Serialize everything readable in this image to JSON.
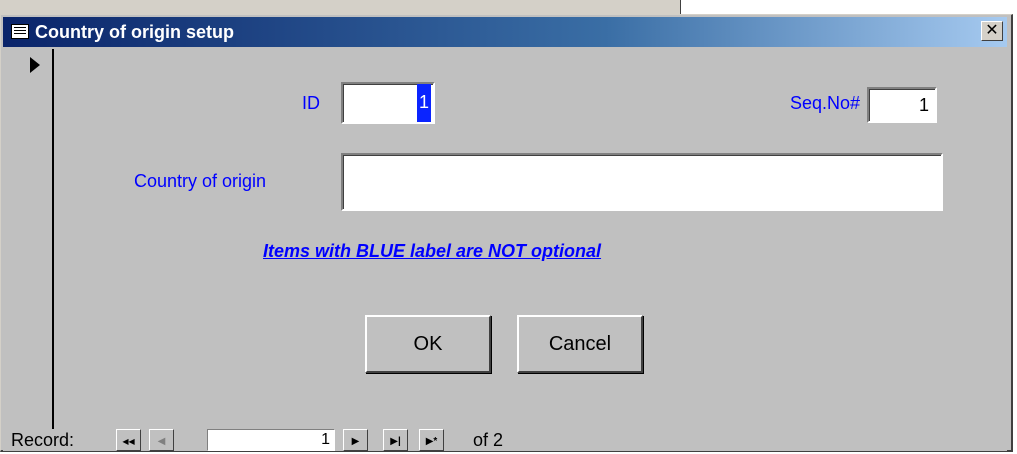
{
  "window": {
    "title": "Country of origin setup",
    "close_glyph": "✕"
  },
  "form": {
    "id_label": "ID",
    "id_value": "1",
    "seq_label": "Seq.No#",
    "seq_value": "1",
    "country_label": "Country of origin",
    "country_value": "",
    "notice": "Items with BLUE label are NOT optional"
  },
  "buttons": {
    "ok": "OK",
    "cancel": "Cancel"
  },
  "navigation": {
    "record_label": "Record:",
    "current": "1",
    "of_text": "of",
    "total": "2",
    "first_glyph": "◀◀",
    "prev_glyph": "◀",
    "next_glyph": "▶",
    "last_glyph": "▶|",
    "new_glyph": "▶*"
  },
  "colors": {
    "label_blue": "#0000ff",
    "title_blue": "#0a246a",
    "face": "#c0c0c0"
  }
}
